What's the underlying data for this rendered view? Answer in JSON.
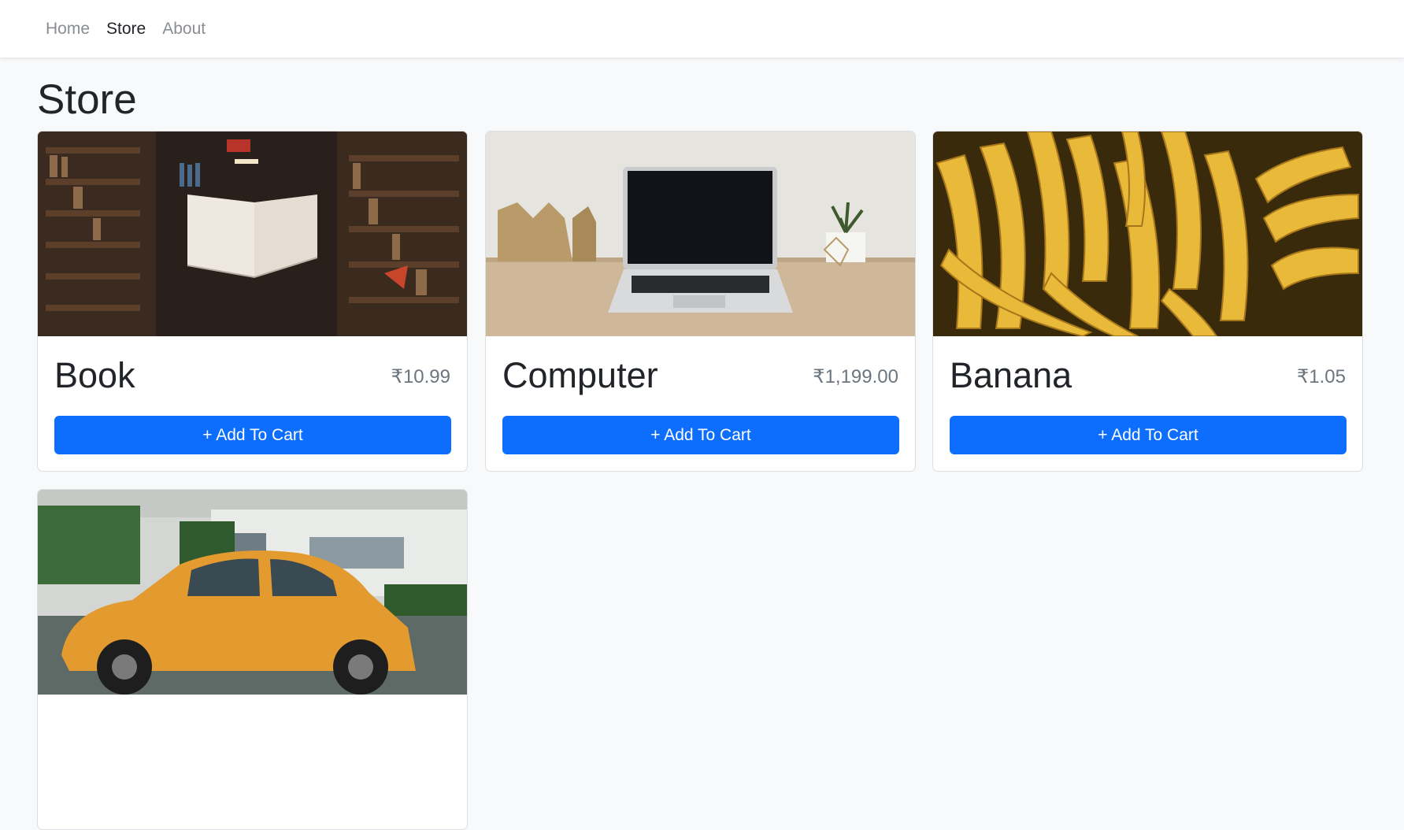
{
  "nav": {
    "items": [
      {
        "label": "Home"
      },
      {
        "label": "Store"
      },
      {
        "label": "About"
      }
    ]
  },
  "page": {
    "title": "Store"
  },
  "products": [
    {
      "name": "Book",
      "price": "₹10.99",
      "button": "+ Add To Cart",
      "image": "book-image"
    },
    {
      "name": "Computer",
      "price": "₹1,199.00",
      "button": "+ Add To Cart",
      "image": "laptop-image"
    },
    {
      "name": "Banana",
      "price": "₹1.05",
      "button": "+ Add To Cart",
      "image": "banana-image"
    },
    {
      "name": "",
      "price": "",
      "button": "",
      "image": "car-image"
    }
  ],
  "colors": {
    "primary": "#0d6efd",
    "background": "#f8f9fa",
    "price": "#6c757d"
  }
}
